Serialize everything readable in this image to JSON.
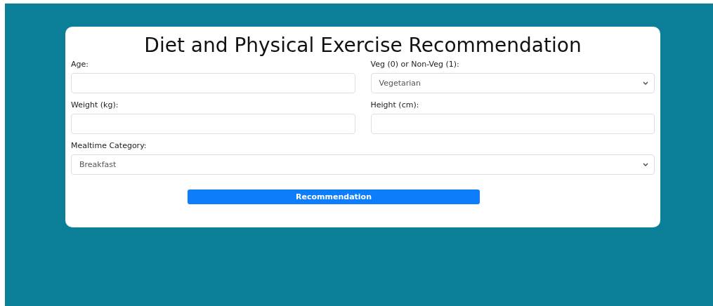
{
  "title": "Diet and Physical Exercise Recommendation",
  "rows": [
    [
      {
        "label": "Age:",
        "kind": "text"
      },
      {
        "label": "Veg (0) or Non-Veg (1):",
        "kind": "select",
        "value": "Vegetarian"
      }
    ],
    [
      {
        "label": "Weight (kg):",
        "kind": "text"
      },
      {
        "label": "Height (cm):",
        "kind": "text"
      }
    ],
    [
      {
        "label": "Mealtime Category:",
        "kind": "select",
        "value": "Breakfast"
      }
    ]
  ],
  "button": "Recommendation"
}
